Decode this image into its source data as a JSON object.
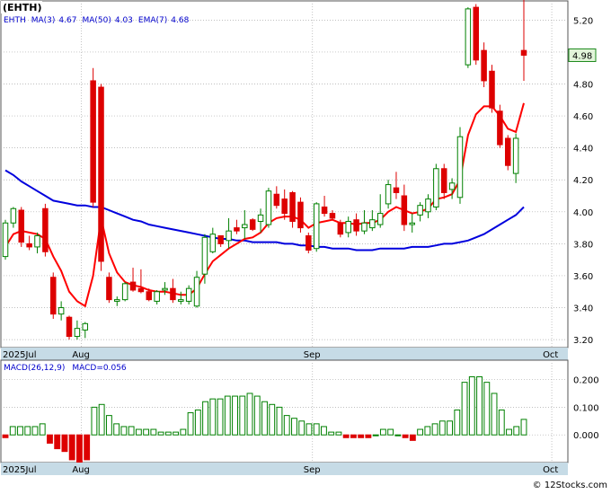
{
  "symbol_title": "(EHTH)",
  "watermark": "© 12Stocks.com",
  "price_legend": {
    "symbol": "EHTH",
    "ma3_label": "MA(3)",
    "ma3_value": "4.67",
    "ma50_label": "MA(50)",
    "ma50_value": "4.03",
    "ema7_label": "EMA(7)",
    "ema7_value": "4.68"
  },
  "macd_legend": {
    "params": "MACD(26,12,9)",
    "value_label": "MACD=0.056"
  },
  "last_price_label": "4.98",
  "x_labels": [
    {
      "text": "2025Jul",
      "index": 0
    },
    {
      "text": "Aug",
      "index": 10
    },
    {
      "text": "Sep",
      "index": 39
    },
    {
      "text": "Oct",
      "index": 69
    }
  ],
  "colors": {
    "up_candle": "#008000",
    "down_candle": "#dd0000",
    "ma_fast": "#ff0000",
    "ma_slow": "#0000dd",
    "grid": "#aaaaaa",
    "date_bar": "#c6dbe6",
    "price_tag_bg": "#e2f5da",
    "price_tag_border": "#1c8a1c",
    "price_tag_text": "#000000",
    "text_blue": "#0000cc",
    "title_text": "#000000"
  },
  "chart_data": [
    {
      "type": "candlestick",
      "title": "(EHTH)",
      "ylim": [
        3.15,
        5.32
      ],
      "y_ticks": [
        "5.20",
        "5.00",
        "4.80",
        "4.60",
        "4.40",
        "4.20",
        "4.00",
        "3.80",
        "3.60",
        "3.40",
        "3.20"
      ],
      "grid": true,
      "series": [
        {
          "name": "EHTH",
          "candles": [
            [
              3.72,
              3.95,
              3.7,
              3.93
            ],
            [
              3.93,
              4.03,
              3.9,
              4.02
            ],
            [
              4.01,
              4.03,
              3.78,
              3.81
            ],
            [
              3.8,
              3.85,
              3.76,
              3.78
            ],
            [
              3.78,
              3.87,
              3.74,
              3.85
            ],
            [
              4.02,
              4.05,
              3.72,
              3.75
            ],
            [
              3.59,
              3.62,
              3.33,
              3.36
            ],
            [
              3.36,
              3.44,
              3.32,
              3.4
            ],
            [
              3.34,
              3.35,
              3.2,
              3.22
            ],
            [
              3.22,
              3.32,
              3.2,
              3.27
            ],
            [
              3.26,
              3.31,
              3.21,
              3.3
            ],
            [
              4.82,
              4.9,
              4.03,
              4.06
            ],
            [
              4.78,
              4.8,
              3.63,
              3.69
            ],
            [
              3.59,
              3.62,
              3.43,
              3.45
            ],
            [
              3.44,
              3.47,
              3.41,
              3.45
            ],
            [
              3.45,
              3.56,
              3.44,
              3.55
            ],
            [
              3.56,
              3.65,
              3.5,
              3.51
            ],
            [
              3.52,
              3.64,
              3.49,
              3.5
            ],
            [
              3.5,
              3.52,
              3.44,
              3.45
            ],
            [
              3.44,
              3.51,
              3.42,
              3.5
            ],
            [
              3.51,
              3.56,
              3.48,
              3.52
            ],
            [
              3.52,
              3.58,
              3.43,
              3.45
            ],
            [
              3.44,
              3.5,
              3.42,
              3.45
            ],
            [
              3.44,
              3.54,
              3.42,
              3.52
            ],
            [
              3.41,
              3.63,
              3.4,
              3.59
            ],
            [
              3.61,
              3.86,
              3.55,
              3.84
            ],
            [
              3.75,
              3.9,
              3.74,
              3.86
            ],
            [
              3.85,
              3.85,
              3.78,
              3.8
            ],
            [
              3.82,
              3.96,
              3.77,
              3.88
            ],
            [
              3.9,
              3.95,
              3.86,
              3.88
            ],
            [
              3.9,
              4.01,
              3.83,
              3.92
            ],
            [
              3.95,
              3.96,
              3.88,
              3.89
            ],
            [
              3.94,
              4.02,
              3.87,
              3.98
            ],
            [
              3.92,
              4.15,
              3.9,
              4.13
            ],
            [
              4.11,
              4.16,
              4.02,
              4.04
            ],
            [
              4.08,
              4.14,
              3.95,
              3.99
            ],
            [
              4.12,
              4.13,
              3.9,
              3.94
            ],
            [
              4.06,
              4.09,
              3.87,
              3.9
            ],
            [
              3.85,
              3.87,
              3.74,
              3.76
            ],
            [
              3.77,
              4.06,
              3.75,
              4.05
            ],
            [
              4.03,
              4.1,
              3.97,
              3.99
            ],
            [
              3.99,
              4.01,
              3.95,
              3.96
            ],
            [
              3.93,
              3.95,
              3.84,
              3.86
            ],
            [
              3.87,
              3.97,
              3.84,
              3.94
            ],
            [
              3.95,
              3.99,
              3.85,
              3.88
            ],
            [
              3.88,
              4.01,
              3.86,
              3.93
            ],
            [
              3.9,
              4.01,
              3.88,
              3.95
            ],
            [
              3.92,
              4.11,
              3.9,
              3.99
            ],
            [
              4.05,
              4.2,
              4.02,
              4.17
            ],
            [
              4.15,
              4.25,
              4.08,
              4.12
            ],
            [
              4.1,
              4.17,
              3.88,
              3.92
            ],
            [
              3.92,
              3.99,
              3.87,
              3.93
            ],
            [
              3.98,
              4.06,
              3.94,
              4.04
            ],
            [
              4.0,
              4.11,
              3.96,
              4.08
            ],
            [
              4.03,
              4.3,
              4.01,
              4.27
            ],
            [
              4.27,
              4.3,
              4.08,
              4.12
            ],
            [
              4.14,
              4.21,
              4.08,
              4.18
            ],
            [
              4.09,
              4.53,
              4.05,
              4.47
            ],
            [
              4.92,
              5.28,
              4.9,
              5.27
            ],
            [
              5.28,
              5.3,
              4.92,
              4.95
            ],
            [
              5.01,
              5.06,
              4.78,
              4.82
            ],
            [
              4.88,
              4.92,
              4.62,
              4.65
            ],
            [
              4.63,
              4.67,
              4.4,
              4.42
            ],
            [
              4.46,
              4.48,
              4.26,
              4.29
            ],
            [
              4.24,
              4.49,
              4.18,
              4.46
            ],
            [
              5.01,
              5.34,
              4.82,
              4.98
            ]
          ]
        }
      ]
    },
    {
      "type": "line",
      "title": "",
      "series": [
        {
          "name": "MA(3)",
          "values": [
            3.82,
            3.9,
            3.92,
            3.87,
            3.82,
            3.79,
            3.65,
            3.51,
            3.33,
            3.3,
            3.26,
            3.55,
            3.68,
            3.74,
            3.53,
            3.49,
            3.51,
            3.52,
            3.49,
            3.49,
            3.49,
            3.49,
            3.47,
            3.48,
            3.52,
            3.65,
            3.77,
            3.84,
            3.85,
            3.86,
            3.89,
            3.9,
            3.93,
            4.0,
            4.05,
            4.05,
            3.99,
            3.95,
            3.87,
            3.91,
            3.94,
            4.0,
            3.94,
            3.92,
            3.89,
            3.92,
            3.92,
            3.96,
            4.04,
            4.09,
            4.07,
            3.99,
            3.96,
            4.02,
            4.13,
            4.16,
            4.19,
            4.26,
            4.64,
            4.9,
            5.01,
            4.81,
            4.63,
            4.45,
            4.39,
            4.58
          ]
        },
        {
          "name": "MA(50)",
          "values": [
            4.26,
            4.23,
            4.19,
            4.16,
            4.13,
            4.1,
            4.07,
            4.06,
            4.05,
            4.04,
            4.04,
            4.03,
            4.03,
            4.01,
            3.99,
            3.97,
            3.95,
            3.94,
            3.92,
            3.91,
            3.9,
            3.89,
            3.88,
            3.87,
            3.86,
            3.85,
            3.84,
            3.83,
            3.83,
            3.82,
            3.82,
            3.81,
            3.81,
            3.81,
            3.81,
            3.8,
            3.8,
            3.79,
            3.79,
            3.78,
            3.78,
            3.77,
            3.77,
            3.77,
            3.76,
            3.76,
            3.76,
            3.77,
            3.77,
            3.77,
            3.77,
            3.78,
            3.78,
            3.78,
            3.79,
            3.8,
            3.8,
            3.81,
            3.82,
            3.84,
            3.86,
            3.89,
            3.92,
            3.95,
            3.98,
            4.03
          ]
        },
        {
          "name": "EMA(7)",
          "values": [
            3.78,
            3.86,
            3.88,
            3.87,
            3.86,
            3.83,
            3.72,
            3.63,
            3.5,
            3.44,
            3.41,
            3.6,
            3.96,
            3.74,
            3.62,
            3.56,
            3.54,
            3.53,
            3.51,
            3.5,
            3.5,
            3.49,
            3.48,
            3.48,
            3.52,
            3.61,
            3.69,
            3.73,
            3.77,
            3.8,
            3.83,
            3.84,
            3.87,
            3.93,
            3.96,
            3.97,
            3.97,
            3.95,
            3.9,
            3.93,
            3.94,
            3.95,
            3.93,
            3.93,
            3.92,
            3.93,
            3.93,
            3.95,
            4.0,
            4.03,
            4.01,
            3.99,
            4.0,
            4.02,
            4.08,
            4.09,
            4.11,
            4.2,
            4.48,
            4.61,
            4.66,
            4.66,
            4.6,
            4.52,
            4.5,
            4.68
          ]
        }
      ]
    },
    {
      "type": "bar",
      "title": "MACD(26,12,9)",
      "ylim": [
        -0.1,
        0.27
      ],
      "y_ticks": [
        "0.200",
        "0.100",
        "0.000"
      ],
      "series": [
        {
          "name": "MACD",
          "values": [
            -0.01,
            0.03,
            0.03,
            0.03,
            0.03,
            0.04,
            -0.03,
            -0.05,
            -0.06,
            -0.09,
            -0.1,
            -0.09,
            0.1,
            0.11,
            0.07,
            0.04,
            0.03,
            0.03,
            0.02,
            0.02,
            0.02,
            0.01,
            0.01,
            0.01,
            0.02,
            0.08,
            0.09,
            0.12,
            0.13,
            0.13,
            0.14,
            0.14,
            0.14,
            0.15,
            0.14,
            0.12,
            0.11,
            0.1,
            0.07,
            0.06,
            0.05,
            0.04,
            0.04,
            0.03,
            0.01,
            0.01,
            -0.01,
            -0.01,
            -0.01,
            -0.01,
            0.0,
            0.02,
            0.02,
            0.0,
            -0.01,
            -0.02,
            0.02,
            0.03,
            0.04,
            0.05,
            0.05,
            0.09,
            0.19,
            0.21,
            0.21,
            0.19,
            0.15,
            0.09,
            0.02,
            0.03,
            0.056
          ]
        }
      ]
    }
  ]
}
